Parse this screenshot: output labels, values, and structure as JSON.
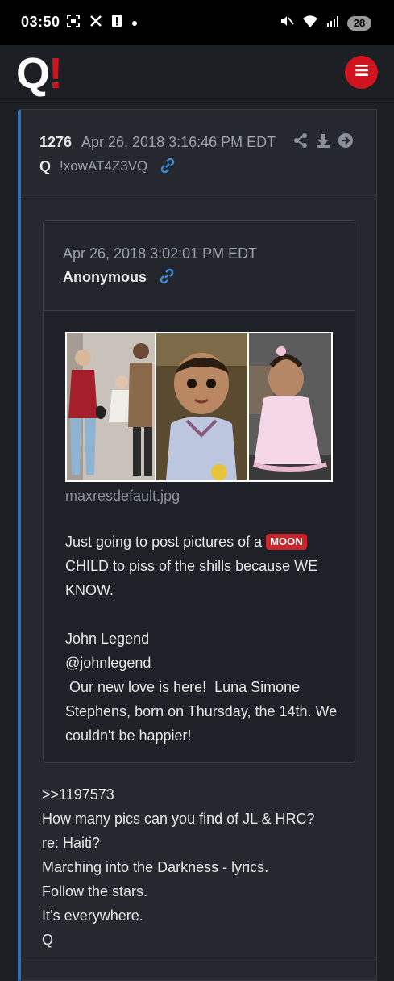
{
  "status_bar": {
    "time": "03:50",
    "battery": "28"
  },
  "header": {
    "logo_q": "Q",
    "logo_bang": "!"
  },
  "post": {
    "number": "1276",
    "date": "Apr 26, 2018 3:16:46 PM EDT",
    "author": "Q",
    "tripcode": "!xowAT4Z3VQ",
    "quote": {
      "date": "Apr 26, 2018 3:02:01 PM EDT",
      "author": "Anonymous",
      "image_filename": "maxresdefault.jpg",
      "text_line1": "Just going to post pictures of a",
      "badge": "MOON",
      "text_line2": "CHILD to piss of the shills because WE KNOW.",
      "quoted_lines": [
        "John Legend",
        "@johnlegend",
        " Our new love is here!  Luna Simone Stephens, born on Thursday, the 14th. We couldn't be happier!"
      ]
    },
    "reply_lines": [
      ">>1197573",
      "How many pics can you find of JL & HRC?",
      "re: Haiti?",
      "Marching into the Darkness - lyrics.",
      "Follow the stars.",
      "It’s everywhere.",
      "Q"
    ]
  },
  "colors": {
    "accent_red": "#d0141f",
    "link_blue": "#3a8ad6",
    "card_border": "#2f6fb2"
  },
  "icons": [
    "camera-icon",
    "x-icon",
    "alert-icon",
    "mute-icon",
    "wifi-icon",
    "signal-icon",
    "menu-icon",
    "share-icon",
    "download-icon",
    "arrow-right-circle-icon",
    "link-icon"
  ]
}
